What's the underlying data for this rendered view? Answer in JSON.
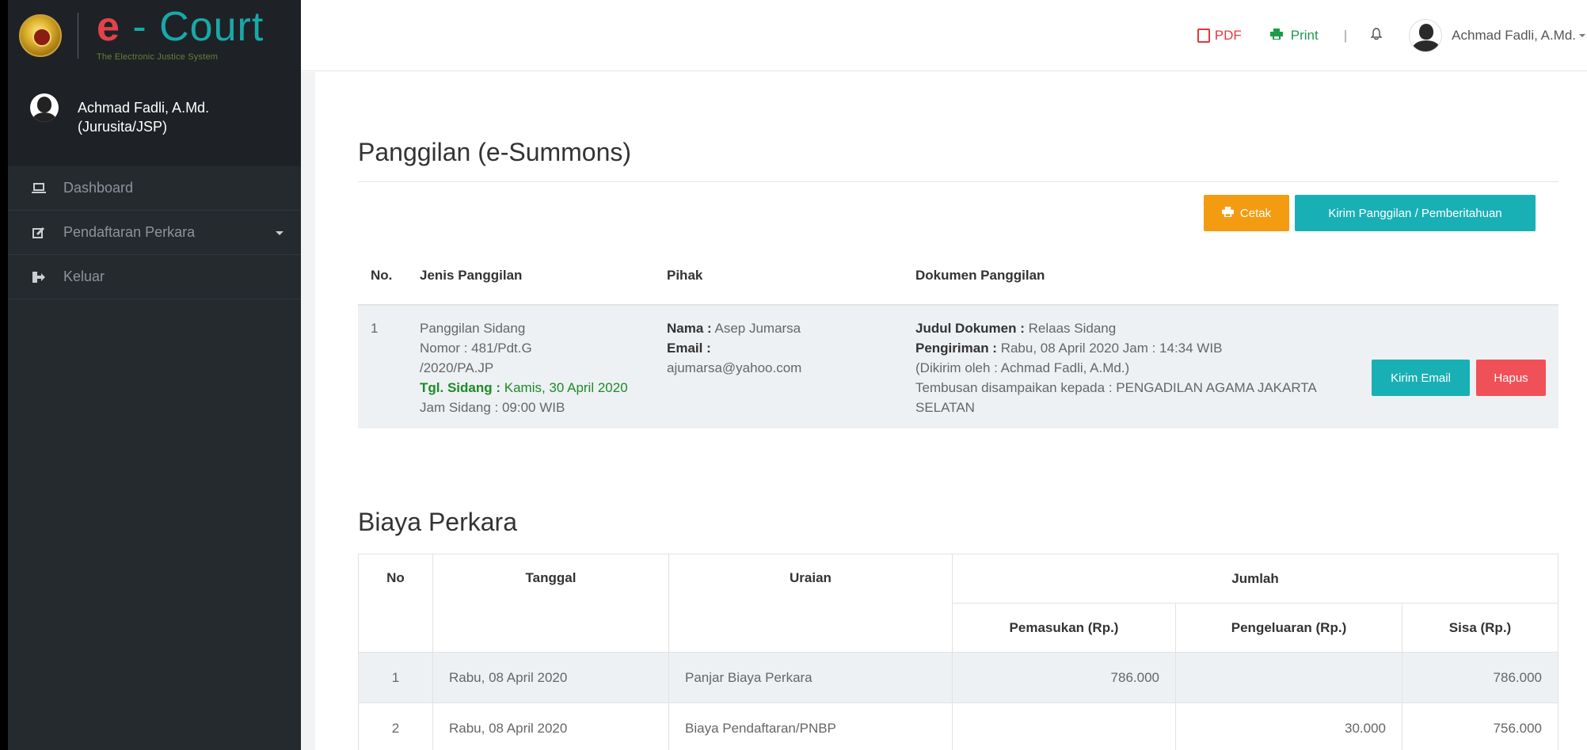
{
  "brand": {
    "title_e": "e",
    "title_rest": " - Court",
    "subtitle": "The Electronic Justice System"
  },
  "sidebar": {
    "user_name": "Achmad Fadli, A.Md.",
    "user_role": "(Jurusita/JSP)",
    "items": [
      {
        "label": "Dashboard",
        "icon": "laptop-icon"
      },
      {
        "label": "Pendaftaran Perkara",
        "icon": "edit-icon"
      },
      {
        "label": "Keluar",
        "icon": "sign-out-icon"
      }
    ]
  },
  "topbar": {
    "pdf_label": "PDF",
    "print_label": "Print",
    "separator": "|",
    "user_name": "Achmad Fadli, A.Md."
  },
  "summons": {
    "title": "Panggilan (e-Summons)",
    "cetak_label": "Cetak",
    "kirim_label": "Kirim Panggilan / Pemberitahuan",
    "headers": [
      "No.",
      "Jenis Panggilan",
      "Pihak",
      "Dokumen Panggilan"
    ],
    "row": {
      "no": "1",
      "jenis_line1": "Panggilan Sidang",
      "jenis_line2": "Nomor : 481/Pdt.G",
      "jenis_line3": "/2020/PA.JP",
      "tgl_label": "Tgl. Sidang :",
      "tgl_value": "Kamis, 30 April 2020",
      "jam": "Jam Sidang : 09:00 WIB",
      "nama_label": "Nama :",
      "nama_value": "Asep Jumarsa",
      "email_label": "Email :",
      "email_value": "ajumarsa@yahoo.com",
      "judul_label": "Judul Dokumen :",
      "judul_value": "Relaas Sidang",
      "pengiriman_label": "Pengiriman :",
      "pengiriman_value": "Rabu, 08 April 2020 Jam : 14:34 WIB",
      "dikirim": "(Dikirim oleh : Achmad Fadli, A.Md.)",
      "tembusan": "Tembusan disampaikan kepada : PENGADILAN AGAMA JAKARTA SELATAN",
      "email_btn": "Kirim Email",
      "hapus_btn": "Hapus"
    }
  },
  "biaya": {
    "title": "Biaya Perkara",
    "headers": {
      "no": "No",
      "tanggal": "Tanggal",
      "uraian": "Uraian",
      "jumlah": "Jumlah",
      "pemasukan": "Pemasukan (Rp.)",
      "pengeluaran": "Pengeluaran (Rp.)",
      "sisa": "Sisa (Rp.)"
    },
    "rows": [
      {
        "no": "1",
        "tanggal": "Rabu, 08 April 2020",
        "uraian": "Panjar Biaya Perkara",
        "pemasukan": "786.000",
        "pengeluaran": "",
        "sisa": "786.000"
      },
      {
        "no": "2",
        "tanggal": "Rabu, 08 April 2020",
        "uraian": "Biaya Pendaftaran/PNBP",
        "pemasukan": "",
        "pengeluaran": "30.000",
        "sisa": "756.000"
      }
    ]
  }
}
